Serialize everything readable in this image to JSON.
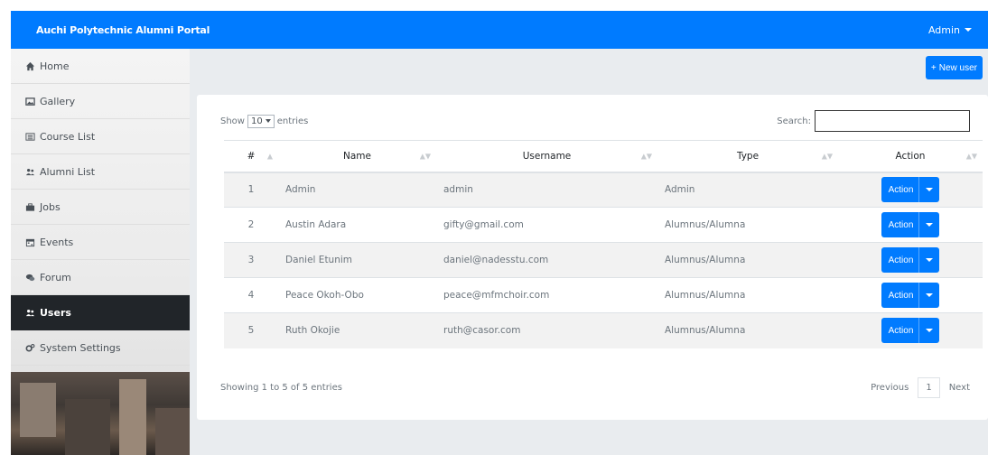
{
  "navbar": {
    "brand": "Auchi Polytechnic Alumni Portal",
    "user_menu": "Admin"
  },
  "sidebar": {
    "items": [
      {
        "label": "Home",
        "icon": "home-icon"
      },
      {
        "label": "Gallery",
        "icon": "image-icon"
      },
      {
        "label": "Course List",
        "icon": "list-icon"
      },
      {
        "label": "Alumni List",
        "icon": "users-icon"
      },
      {
        "label": "Jobs",
        "icon": "briefcase-icon"
      },
      {
        "label": "Events",
        "icon": "calendar-icon"
      },
      {
        "label": "Forum",
        "icon": "comments-icon"
      },
      {
        "label": "Users",
        "icon": "users-icon",
        "active": true
      },
      {
        "label": "System Settings",
        "icon": "cogs-icon"
      }
    ]
  },
  "main": {
    "new_user_label": "New user"
  },
  "table": {
    "show_label": "Show",
    "entries_label": "entries",
    "length_value": "10",
    "search_label": "Search:",
    "columns": [
      "#",
      "Name",
      "Username",
      "Type",
      "Action"
    ],
    "rows": [
      {
        "num": "1",
        "name": "Admin",
        "username": "admin",
        "type": "Admin",
        "action": "Action"
      },
      {
        "num": "2",
        "name": "Austin Adara",
        "username": "gifty@gmail.com",
        "type": "Alumnus/Alumna",
        "action": "Action"
      },
      {
        "num": "3",
        "name": "Daniel Etunim",
        "username": "daniel@nadesstu.com",
        "type": "Alumnus/Alumna",
        "action": "Action"
      },
      {
        "num": "4",
        "name": "Peace Okoh-Obo",
        "username": "peace@mfmchoir.com",
        "type": "Alumnus/Alumna",
        "action": "Action"
      },
      {
        "num": "5",
        "name": "Ruth Okojie",
        "username": "ruth@casor.com",
        "type": "Alumnus/Alumna",
        "action": "Action"
      }
    ],
    "info": "Showing 1 to 5 of 5 entries",
    "previous": "Previous",
    "current_page": "1",
    "next": "Next"
  },
  "colors": {
    "primary": "#007bff",
    "sidebar_active": "#212529"
  }
}
